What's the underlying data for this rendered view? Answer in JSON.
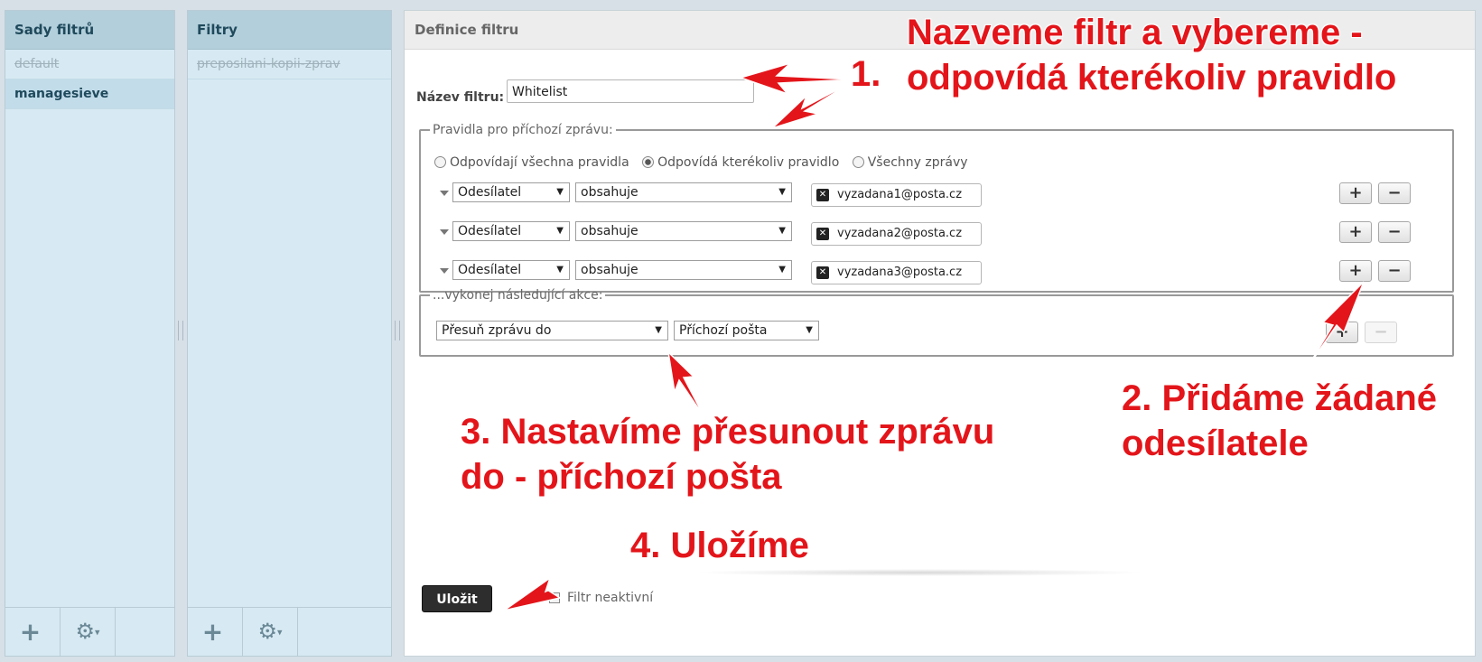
{
  "filter_sets": {
    "title": "Sady filtrů",
    "items": [
      {
        "label": "default",
        "state": "disabled"
      },
      {
        "label": "managesieve",
        "state": "selected"
      }
    ]
  },
  "filters": {
    "title": "Filtry",
    "items": [
      {
        "label": "preposilani-kopii-zprav",
        "state": "disabled"
      }
    ]
  },
  "footer_icons": {
    "add": "+",
    "gear": "⚙",
    "caret": "▾"
  },
  "definition": {
    "title": "Definice filtru",
    "name_label": "Název filtru:",
    "name_value": "Whitelist",
    "rules_legend": "Pravidla pro příchozí zprávu:",
    "radios": [
      {
        "label": "Odpovídají všechna pravidla",
        "checked": false
      },
      {
        "label": "Odpovídá kterékoliv pravidlo",
        "checked": true
      },
      {
        "label": "Všechny zprávy",
        "checked": false
      }
    ],
    "rules": [
      {
        "header": "Odesílatel",
        "op": "obsahuje",
        "value": "vyzadana1@posta.cz"
      },
      {
        "header": "Odesílatel",
        "op": "obsahuje",
        "value": "vyzadana2@posta.cz"
      },
      {
        "header": "Odesílatel",
        "op": "obsahuje",
        "value": "vyzadana3@posta.cz"
      }
    ],
    "add_symbol": "+",
    "remove_symbol": "−",
    "actions_legend": "...vykonej následující akce:",
    "action": {
      "type": "Přesuň zprávu do",
      "target": "Příchozí pošta"
    },
    "save_label": "Uložit",
    "inactive_label": "Filtr neaktivní"
  },
  "annotations": {
    "a1_line1": "Nazveme filtr a vybereme -",
    "a1_line2": "odpovídá kterékoliv pravidlo",
    "a1_num": "1.",
    "a2_line1": "2. Přidáme žádané",
    "a2_line2": "odesílatele",
    "a3_line1": "3. Nastavíme přesunout zprávu",
    "a3_line2": "do - příchozí pošta",
    "a4": "4. Uložíme",
    "color": "#e3151a"
  }
}
